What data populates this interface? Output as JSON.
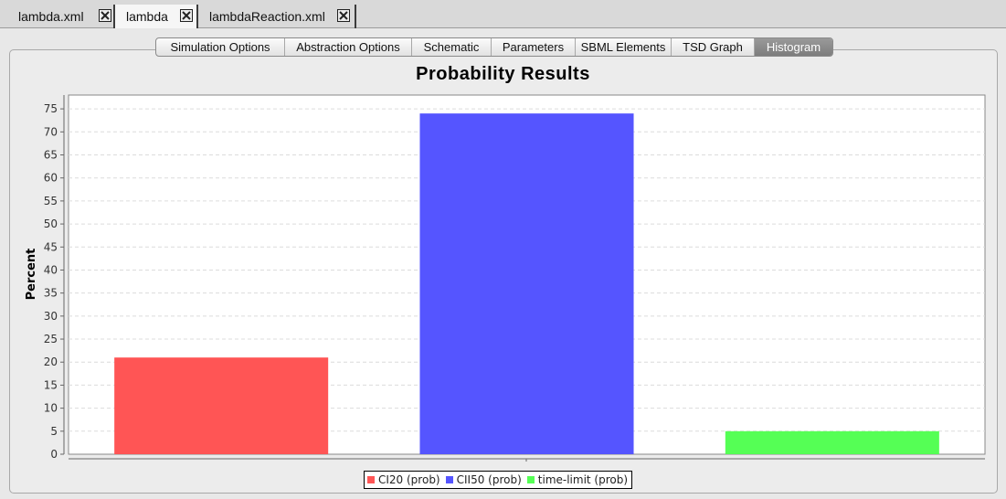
{
  "doc_tabs": [
    {
      "label": "lambda.xml",
      "active": false
    },
    {
      "label": "lambda",
      "active": true
    },
    {
      "label": "lambdaReaction.xml",
      "active": false
    }
  ],
  "sub_tabs": [
    "Simulation Options",
    "Abstraction Options",
    "Schematic",
    "Parameters",
    "SBML Elements",
    "TSD Graph",
    "Histogram"
  ],
  "selected_sub_tab": "Histogram",
  "icons": {
    "tab_close": "close-x-icon"
  },
  "colors": {
    "series1": "#ff5555",
    "series2": "#5555ff",
    "series3": "#55ff55"
  },
  "chart_data": {
    "type": "bar",
    "title": "Probability Results",
    "xlabel": "",
    "ylabel": "Percent",
    "ylim": [
      0,
      78
    ],
    "yticks": [
      0,
      5,
      10,
      15,
      20,
      25,
      30,
      35,
      40,
      45,
      50,
      55,
      60,
      65,
      70,
      75
    ],
    "grid": true,
    "legend_position": "bottom",
    "series": [
      {
        "name": "CI20 (prob)",
        "value": 21
      },
      {
        "name": "CII50 (prob)",
        "value": 74
      },
      {
        "name": "time-limit (prob)",
        "value": 5
      }
    ]
  }
}
